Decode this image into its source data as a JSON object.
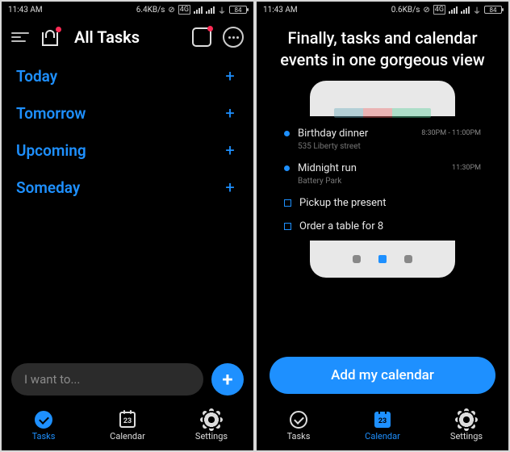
{
  "left": {
    "status": {
      "time": "11:43 AM",
      "net": "6.4KB/s",
      "battery": "84"
    },
    "header": {
      "title": "All Tasks"
    },
    "sections": [
      {
        "label": "Today"
      },
      {
        "label": "Tomorrow"
      },
      {
        "label": "Upcoming"
      },
      {
        "label": "Someday"
      }
    ],
    "input": {
      "placeholder": "I want to..."
    },
    "tabs": {
      "tasks": "Tasks",
      "calendar": "Calendar",
      "settings": "Settings",
      "cal_day": "23"
    }
  },
  "right": {
    "status": {
      "time": "11:43 AM",
      "net": "0.6KB/s",
      "battery": "84"
    },
    "promo": {
      "title": "Finally, tasks and calendar events in one gorgeous view"
    },
    "events": [
      {
        "kind": "cal",
        "title": "Birthday dinner",
        "sub": "535 Liberty street",
        "time": "8:30PM - 11:00PM"
      },
      {
        "kind": "cal",
        "title": "Midnight run",
        "sub": "Battery Park",
        "time": "11:30PM"
      },
      {
        "kind": "task",
        "title": "Pickup the present"
      },
      {
        "kind": "task",
        "title": "Order a table for 8"
      }
    ],
    "cta": "Add my calendar",
    "tabs": {
      "tasks": "Tasks",
      "calendar": "Calendar",
      "settings": "Settings",
      "cal_day": "23"
    }
  }
}
